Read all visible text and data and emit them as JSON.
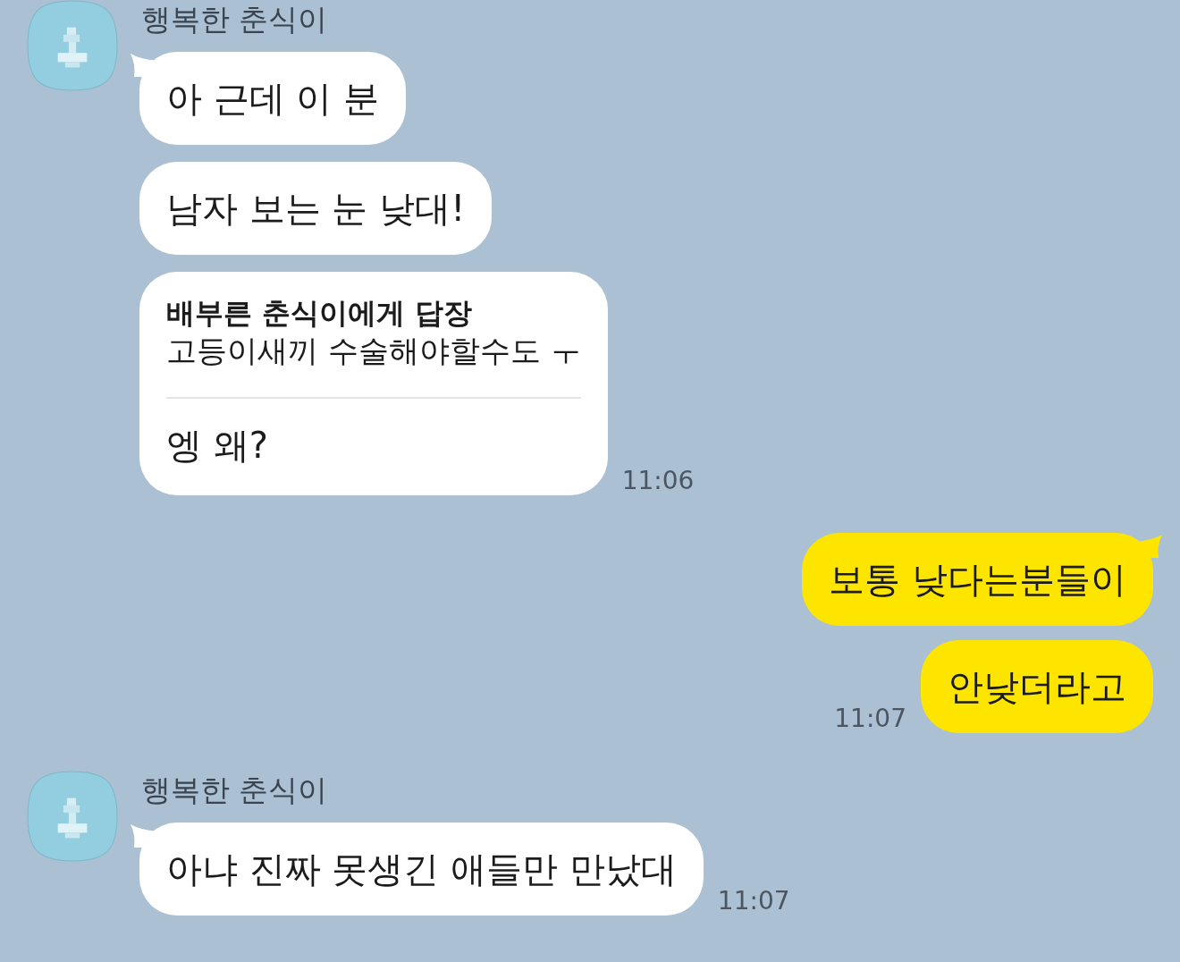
{
  "groups": [
    {
      "kind": "incoming",
      "sender": "행복한 춘식이",
      "messages": [
        {
          "text": "아 근데 이 분"
        },
        {
          "text": "남자 보는 눈 낮대!"
        },
        {
          "reply_to": "배부른 춘식이에게 답장",
          "quoted": "고등이새끼 수술해야할수도 ㅜ",
          "text": "엥 왜?",
          "time": "11:06"
        }
      ]
    },
    {
      "kind": "outgoing",
      "messages": [
        {
          "text": "보통 낮다는분들이"
        },
        {
          "text": "안낮더라고",
          "time": "11:07"
        }
      ]
    },
    {
      "kind": "incoming",
      "sender": "행복한 춘식이",
      "messages": [
        {
          "text": "아냐 진짜 못생긴 애들만 만났대",
          "time": "11:07"
        }
      ]
    }
  ]
}
